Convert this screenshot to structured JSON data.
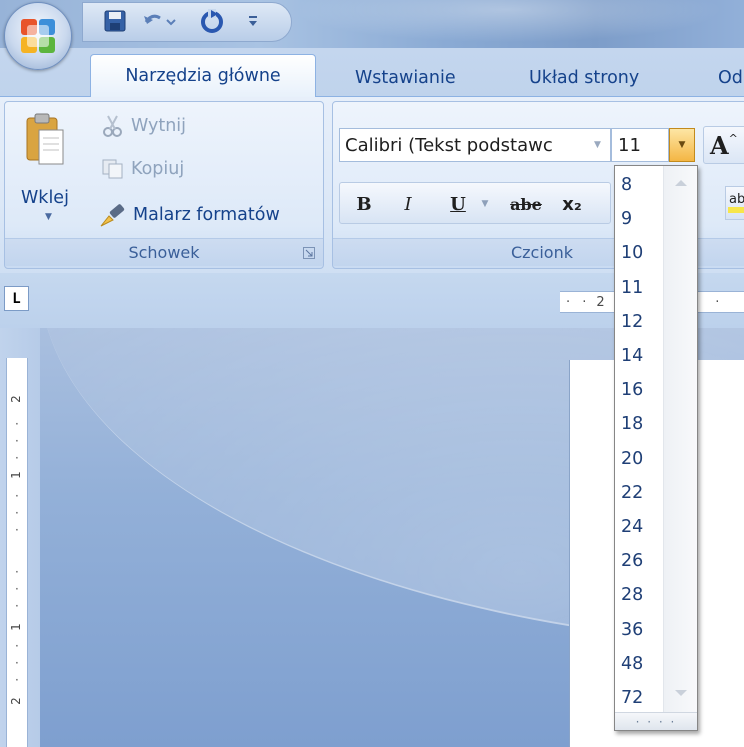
{
  "title_bar": {
    "office_button_icon": "office-logo-icon",
    "quick_access": [
      {
        "name": "save-icon"
      },
      {
        "name": "undo-icon"
      },
      {
        "name": "redo-icon"
      },
      {
        "name": "customize-qat-icon"
      }
    ]
  },
  "tabs": [
    {
      "label": "Narzędzia główne",
      "active": true
    },
    {
      "label": "Wstawianie",
      "active": false
    },
    {
      "label": "Układ strony",
      "active": false
    },
    {
      "label": "Od",
      "active": false
    }
  ],
  "clipboard_group": {
    "label": "Schowek",
    "paste_label": "Wklej",
    "cut_label": "Wytnij",
    "copy_label": "Kopiuj",
    "format_painter_label": "Malarz formatów"
  },
  "font_group": {
    "label": "Czcionk",
    "font_name": "Calibri (Tekst podstawc",
    "font_size": "11",
    "bold": "B",
    "italic": "I",
    "underline": "U",
    "strikethrough": "abe",
    "subscript": "x₂",
    "grow_font": "A"
  },
  "ruler": {
    "tab_selector": "L",
    "h_label": "2",
    "v_labels": [
      "2",
      "1",
      "1",
      "2"
    ]
  },
  "font_size_dropdown": {
    "options": [
      "8",
      "9",
      "10",
      "11",
      "12",
      "14",
      "16",
      "18",
      "20",
      "22",
      "24",
      "26",
      "28",
      "36",
      "48",
      "72"
    ],
    "grip": "· · · ·"
  },
  "colors": {
    "ribbon_text": "#15428b",
    "accent_orange": "#f2b64b",
    "workspace_blue": "#8aa9d4"
  }
}
